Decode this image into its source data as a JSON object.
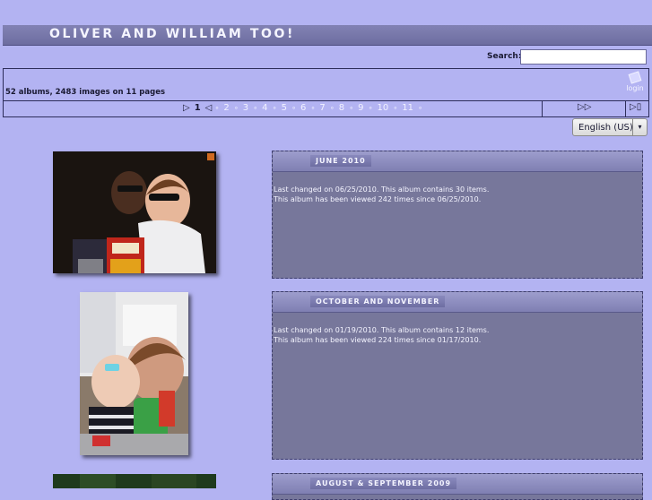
{
  "site": {
    "title": "OLIVER AND WILLIAM TOO!"
  },
  "search": {
    "label": "Search:",
    "value": "",
    "placeholder": ""
  },
  "stats": {
    "text": "52 albums, 2483 images on 11 pages"
  },
  "login": {
    "label": "login"
  },
  "pager": {
    "prev_arrow": "▷",
    "back_arrow": "◁",
    "current": "1",
    "pages": [
      "2",
      "3",
      "4",
      "5",
      "6",
      "7",
      "8",
      "9",
      "10",
      "11"
    ],
    "page_marker": "∘",
    "next_label": "▷▷",
    "last_label": "▷▯"
  },
  "language": {
    "selected": "English (US)",
    "arrow": "▾"
  },
  "albums": [
    {
      "title": "JUNE 2010",
      "line1": "Last changed on 06/25/2010. This album contains 30 items.",
      "line2": "This album has been viewed 242 times since 06/25/2010."
    },
    {
      "title": "OCTOBER AND NOVEMBER",
      "line1": "Last changed on 01/19/2010. This album contains 12 items.",
      "line2": "This album has been viewed 224 times since 01/17/2010."
    },
    {
      "title": "AUGUST & SEPTEMBER 2009"
    }
  ],
  "colors": {
    "background": "#b3b3f2",
    "header": "#7676aa",
    "album_panel": "#77779b",
    "light_text": "#f4f4ff"
  }
}
